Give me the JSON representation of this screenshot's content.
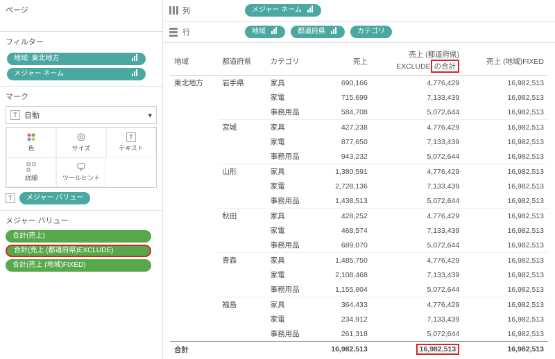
{
  "panels": {
    "pages": "ページ",
    "filters": "フィルター",
    "marks": "マーク",
    "measureValues": "メジャー バリュー"
  },
  "filters": {
    "items": [
      "地域: 東北地方",
      "メジャー ネーム"
    ]
  },
  "marks": {
    "dropdown": "自動",
    "cells": {
      "color": "色",
      "size": "サイズ",
      "text": "テキスト",
      "detail": "詳細",
      "tooltip": "ツールヒント"
    },
    "measure": "メジャー バリュー"
  },
  "measureValues": {
    "items": [
      "合計(売上)",
      "合計(売上 (都道府県)EXCLUDE)",
      "合計(売上 (地域)FIXED)"
    ]
  },
  "shelves": {
    "columns": {
      "label": "列",
      "pills": [
        "メジャー ネーム"
      ]
    },
    "rows": {
      "label": "行",
      "pills": [
        "地域",
        "都道府県",
        "カテゴリ"
      ]
    }
  },
  "tableHeaders": {
    "region": "地域",
    "pref": "都道府県",
    "category": "カテゴリ",
    "sales": "売上",
    "excludeLine1": "売上 (都道府県)",
    "excludeLine2a": "EXCLUDE",
    "excludeLine2b": "の合計",
    "fixed": "売上 (地域)FIXED"
  },
  "region": "東北地方",
  "totalLabel": "合計",
  "chart_data": {
    "type": "table",
    "columns": [
      "都道府県",
      "カテゴリ",
      "売上",
      "売上 (都道府県) EXCLUDE の合計",
      "売上 (地域)FIXED"
    ],
    "rows": [
      [
        "岩手県",
        "家具",
        690166,
        4776429,
        16982513
      ],
      [
        "岩手県",
        "家電",
        715699,
        7133439,
        16982513
      ],
      [
        "岩手県",
        "事務用品",
        584708,
        5072644,
        16982513
      ],
      [
        "宮城",
        "家具",
        427238,
        4776429,
        16982513
      ],
      [
        "宮城",
        "家電",
        877650,
        7133439,
        16982513
      ],
      [
        "宮城",
        "事務用品",
        943232,
        5072644,
        16982513
      ],
      [
        "山形",
        "家具",
        1380591,
        4776429,
        16982513
      ],
      [
        "山形",
        "家電",
        2728136,
        7133439,
        16982513
      ],
      [
        "山形",
        "事務用品",
        1438513,
        5072644,
        16982513
      ],
      [
        "秋田",
        "家具",
        428252,
        4776429,
        16982513
      ],
      [
        "秋田",
        "家電",
        468574,
        7133439,
        16982513
      ],
      [
        "秋田",
        "事務用品",
        689070,
        5072644,
        16982513
      ],
      [
        "青森",
        "家具",
        1485750,
        4776429,
        16982513
      ],
      [
        "青森",
        "家電",
        2108468,
        7133439,
        16982513
      ],
      [
        "青森",
        "事務用品",
        1155804,
        5072644,
        16982513
      ],
      [
        "福島",
        "家具",
        364433,
        4776429,
        16982513
      ],
      [
        "福島",
        "家電",
        234912,
        7133439,
        16982513
      ],
      [
        "福島",
        "事務用品",
        261318,
        5072644,
        16982513
      ]
    ],
    "totals": [
      16982513,
      16982513,
      16982513
    ]
  }
}
